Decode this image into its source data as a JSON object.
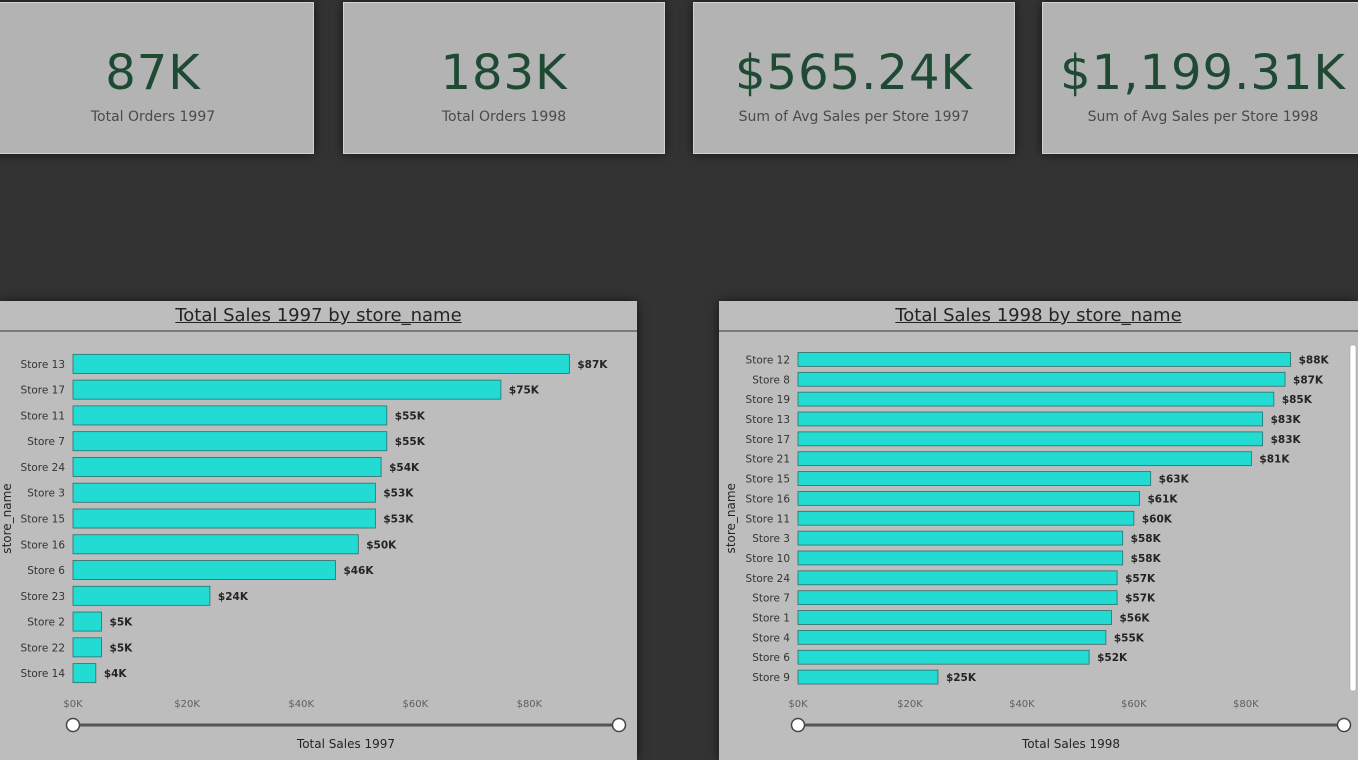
{
  "kpis": [
    {
      "value": "87K",
      "label": "Total Orders 1997"
    },
    {
      "value": "183K",
      "label": "Total Orders 1998"
    },
    {
      "value": "$565.24K",
      "label": "Sum of Avg Sales per Store 1997"
    },
    {
      "value": "$1,199.31K",
      "label": "Sum of Avg Sales per Store 1998"
    }
  ],
  "colors": {
    "bar": "#22dbd2",
    "kpi_value": "#1e4a34",
    "background": "#333333",
    "panel": "#bdbdbd"
  },
  "chart_data": [
    {
      "type": "bar",
      "orientation": "horizontal",
      "title": "Total Sales 1997 by store_name",
      "xlabel": "Total Sales 1997",
      "ylabel": "store_name",
      "xlim": [
        0,
        95000
      ],
      "xticks": [
        0,
        20000,
        40000,
        60000,
        80000
      ],
      "xtick_labels": [
        "$0K",
        "$20K",
        "$40K",
        "$60K",
        "$80K"
      ],
      "categories": [
        "Store 13",
        "Store 17",
        "Store 11",
        "Store 7",
        "Store 24",
        "Store 3",
        "Store 15",
        "Store 16",
        "Store 6",
        "Store 23",
        "Store 2",
        "Store 22",
        "Store 14"
      ],
      "values": [
        87000,
        75000,
        55000,
        55000,
        54000,
        53000,
        53000,
        50000,
        46000,
        24000,
        5000,
        5000,
        4000
      ],
      "data_labels": [
        "$87K",
        "$75K",
        "$55K",
        "$55K",
        "$54K",
        "$53K",
        "$53K",
        "$50K",
        "$46K",
        "$24K",
        "$5K",
        "$5K",
        "$4K"
      ]
    },
    {
      "type": "bar",
      "orientation": "horizontal",
      "title": "Total Sales 1998 by store_name",
      "xlabel": "Total Sales 1998",
      "ylabel": "store_name",
      "xlim": [
        0,
        97000
      ],
      "xticks": [
        0,
        20000,
        40000,
        60000,
        80000
      ],
      "xtick_labels": [
        "$0K",
        "$20K",
        "$40K",
        "$60K",
        "$80K"
      ],
      "categories": [
        "Store 12",
        "Store 8",
        "Store 19",
        "Store 13",
        "Store 17",
        "Store 21",
        "Store 15",
        "Store 16",
        "Store 11",
        "Store 3",
        "Store 10",
        "Store 24",
        "Store 7",
        "Store 1",
        "Store 4",
        "Store 6",
        "Store 9"
      ],
      "values": [
        88000,
        87000,
        85000,
        83000,
        83000,
        81000,
        63000,
        61000,
        60000,
        58000,
        58000,
        57000,
        57000,
        56000,
        55000,
        52000,
        25000
      ],
      "data_labels": [
        "$88K",
        "$87K",
        "$85K",
        "$83K",
        "$83K",
        "$81K",
        "$63K",
        "$61K",
        "$60K",
        "$58K",
        "$58K",
        "$57K",
        "$57K",
        "$56K",
        "$55K",
        "$52K",
        "$25K"
      ]
    }
  ]
}
